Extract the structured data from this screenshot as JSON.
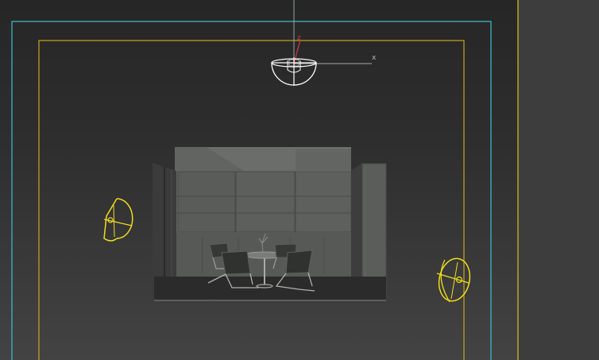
{
  "viewport": {
    "gizmo": {
      "axis_x": "x",
      "axis_z": "z"
    }
  },
  "colors": {
    "background_top": "#262626",
    "background_bottom": "#434343",
    "safe_frame_outer": "#d9c21c",
    "safe_frame_cyan": "#39c2cf",
    "safe_frame_inner": "#c9a520",
    "light_gizmo_selected": "#ffffff",
    "light_gizmo": "#f0dc1e",
    "gizmo_axis_x": "#b8b8b8",
    "gizmo_axis_z": "#d23a3a"
  },
  "icons": [
    "spotlight-top-selected-icon",
    "spotlight-left-icon",
    "spotlight-right-icon",
    "transform-gizmo-icon"
  ]
}
